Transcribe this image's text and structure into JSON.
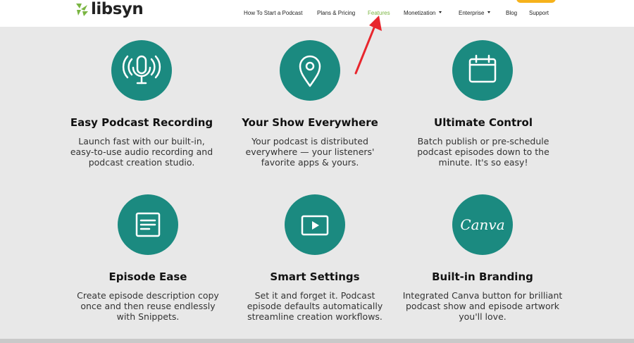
{
  "header": {
    "logo_text": "libsyn",
    "brand_color": "#7ab542",
    "cta_color": "#f6b21b"
  },
  "nav": {
    "items": [
      {
        "label": "How To Start a Podcast"
      },
      {
        "label": "Plans & Pricing"
      },
      {
        "label": "Features",
        "active": true
      },
      {
        "label": "Monetization",
        "dropdown": true
      },
      {
        "label": "Enterprise",
        "dropdown": true
      },
      {
        "label": "Blog"
      },
      {
        "label": "Support"
      }
    ]
  },
  "annotation": {
    "arrow_color": "#e8262d",
    "icon": "red-arrow-icon"
  },
  "features": [
    {
      "icon": "microphone-icon",
      "title": "Easy Podcast Recording",
      "desc": [
        "Launch fast with our built-in,",
        "easy-to-use audio recording and",
        "podcast creation studio."
      ]
    },
    {
      "icon": "location-pin-icon",
      "title": "Your Show Everywhere",
      "desc": [
        "Your podcast is distributed",
        "everywhere — your listeners'",
        "favorite apps & yours."
      ]
    },
    {
      "icon": "calendar-icon",
      "title": "Ultimate Control",
      "desc": [
        "Batch publish or pre-schedule",
        "podcast episodes down to the",
        "minute. It's so easy!"
      ]
    },
    {
      "icon": "document-icon",
      "title": "Episode Ease",
      "desc": [
        "Create episode description copy",
        "once and then reuse endlessly",
        "with Snippets."
      ]
    },
    {
      "icon": "play-screen-icon",
      "title": "Smart Settings",
      "desc": [
        "Set it and forget it. Podcast",
        "episode defaults automatically",
        "streamline creation workflows."
      ]
    },
    {
      "icon": "canva-icon",
      "title": "Built-in Branding",
      "icon_text": "Canva",
      "desc": [
        "Integrated Canva button for brilliant",
        "podcast show and episode artwork",
        "you'll love."
      ]
    }
  ],
  "theme": {
    "circle_color": "#1b8a80",
    "background": "#e8e8e8"
  }
}
